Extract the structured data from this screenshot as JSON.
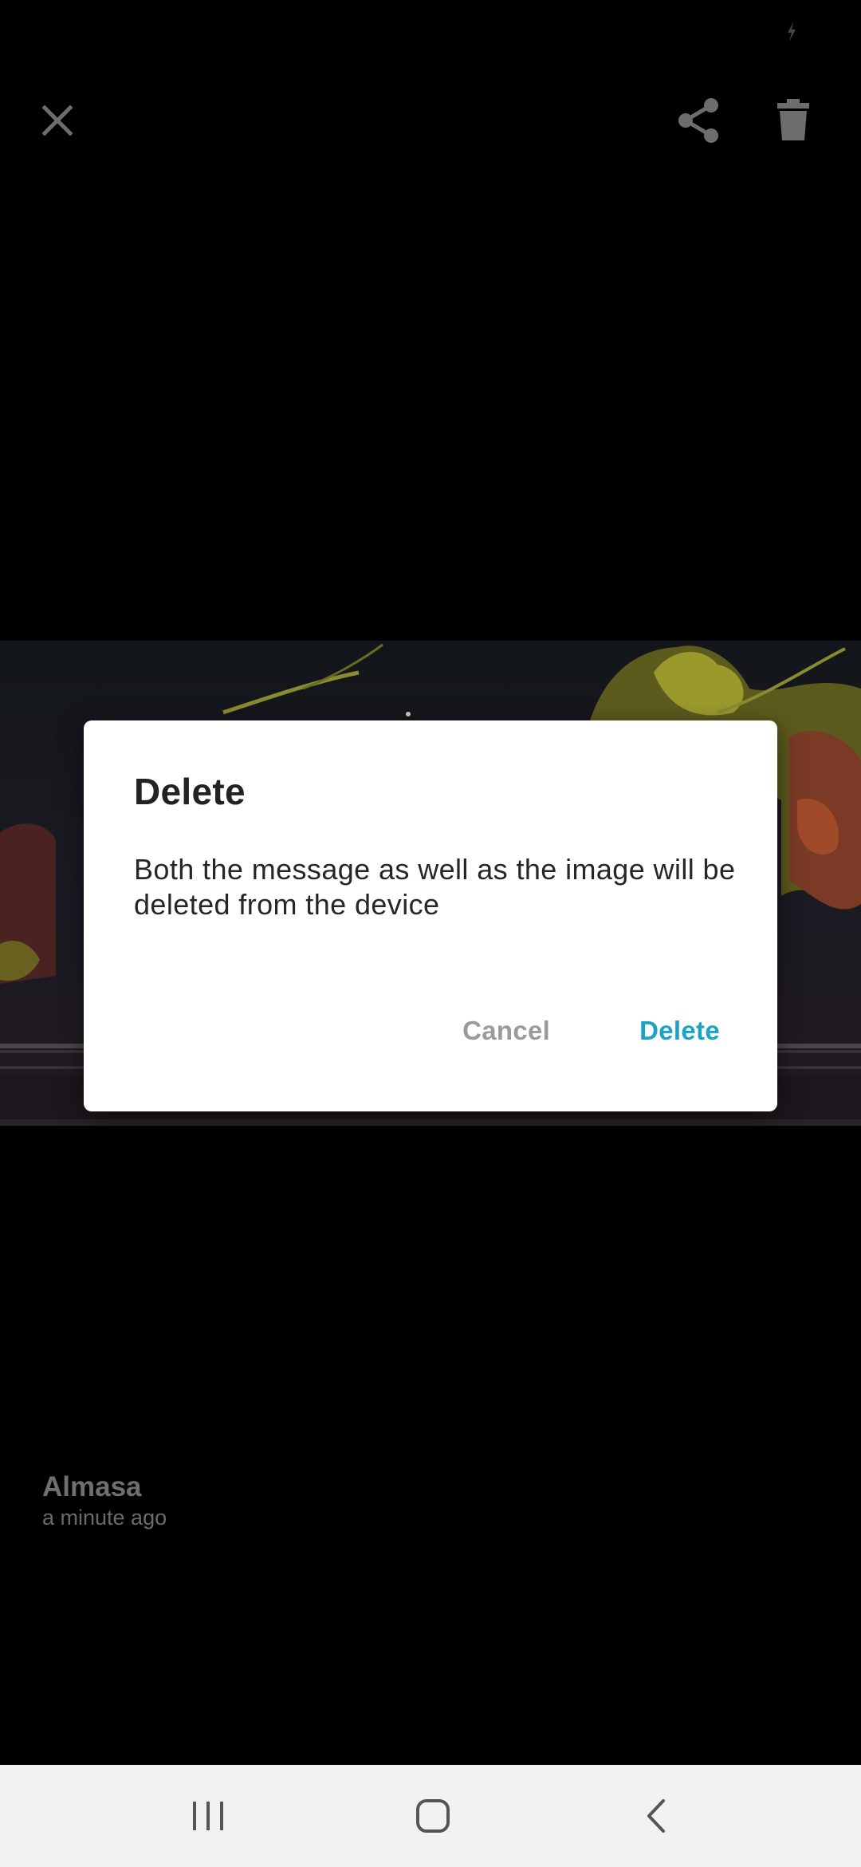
{
  "icons": {
    "status": "charging-bolt-icon",
    "close": "close-icon",
    "share": "share-icon",
    "delete": "trash-icon",
    "nav_recents": "recents-icon",
    "nav_home": "home-icon",
    "nav_back": "back-icon"
  },
  "colors": {
    "background": "#000000",
    "dialog_background": "#ffffff",
    "accent": "#1ba3c6",
    "cancel_text": "#9b9b9b",
    "toolbar_icon": "#6d6d6d",
    "nav_bar": "#f2f2f2"
  },
  "dialog": {
    "title": "Delete",
    "message": "Both the message as well as the image will be deleted from the device",
    "cancel_label": "Cancel",
    "confirm_label": "Delete"
  },
  "message": {
    "sender": "Almasa",
    "time": "a minute ago"
  }
}
